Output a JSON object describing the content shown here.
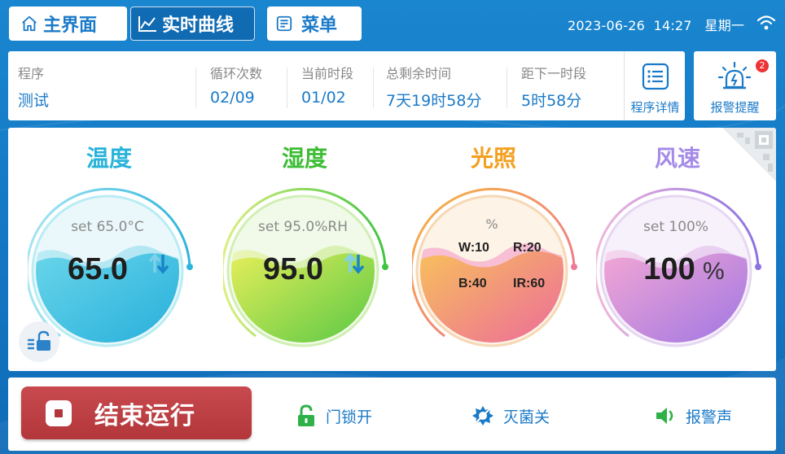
{
  "nav": {
    "home_label": "主界面",
    "curve_label": "实时曲线",
    "menu_label": "菜单"
  },
  "status": {
    "date": "2023-06-26",
    "time": "14:27",
    "weekday": "星期一"
  },
  "program": {
    "program_label": "程序",
    "program_value": "测试",
    "cycle_label": "循环次数",
    "cycle_value": "02/09",
    "segment_label": "当前时段",
    "segment_value": "01/02",
    "remain_label": "总剩余时间",
    "remain_value": "7天19时58分",
    "next_label": "距下一时段",
    "next_value": "5时58分",
    "detail_label": "程序详情",
    "alarm_label": "报警提醒",
    "alarm_count": "2"
  },
  "gauges": {
    "temperature": {
      "title": "温度",
      "set": "set 65.0°C",
      "value": "65.0",
      "level": 0.55
    },
    "humidity": {
      "title": "湿度",
      "set": "set 95.0%RH",
      "value": "95.0",
      "level": 0.55
    },
    "light": {
      "title": "光照",
      "unit": "%",
      "w": "W:10",
      "r": "R:20",
      "b": "B:40",
      "ir": "IR:60",
      "level": 0.5
    },
    "wind": {
      "title": "风速",
      "set": "set 100%",
      "value": "100",
      "unit": "%",
      "level": 0.55
    }
  },
  "colors": {
    "temperature": "#29b3d9",
    "humidity": "#4cc93a",
    "light": "#f2a020",
    "wind": "#a58be8",
    "accent": "#1a7ac8",
    "stop": "#b2363a"
  },
  "controls": {
    "stop_label": "结束运行",
    "door_label": "门锁开",
    "sterilize_label": "灭菌关",
    "alarm_sound_label": "报警声"
  }
}
